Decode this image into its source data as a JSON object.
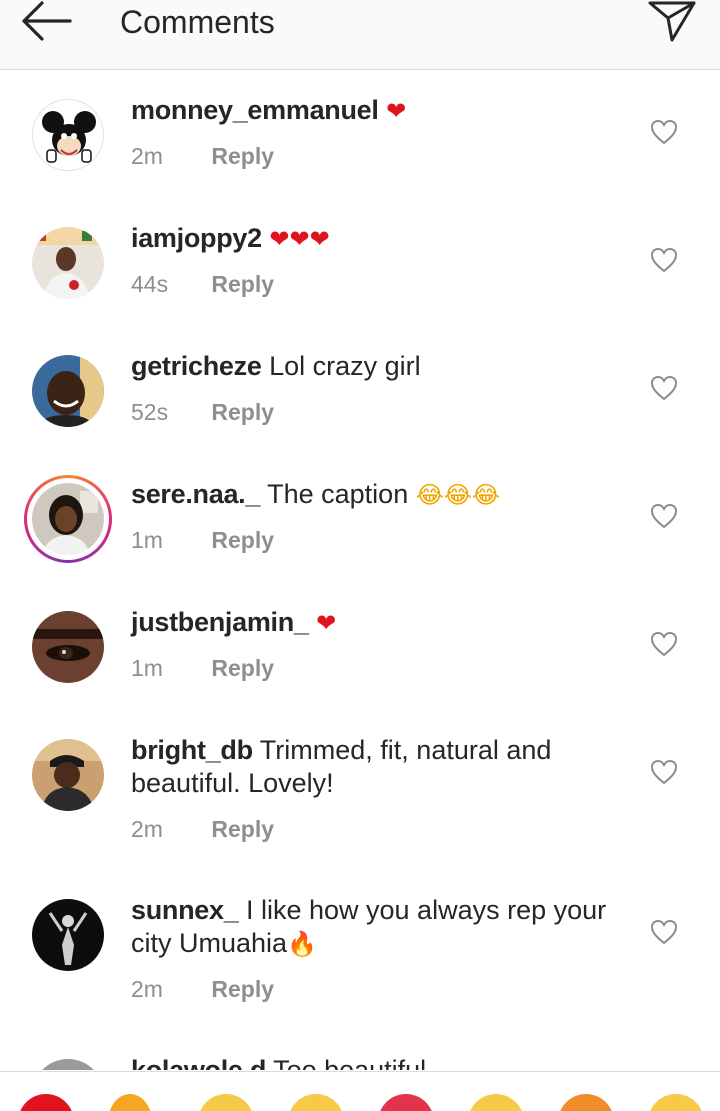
{
  "header": {
    "title": "Comments",
    "back_icon": "arrow-left-icon",
    "share_icon": "direct-send-icon"
  },
  "comments": [
    {
      "username": "monney_emmanuel",
      "text": "",
      "emoji": "❤",
      "time": "2m",
      "reply_label": "Reply",
      "avatar": "mickey-mouse-avatar"
    },
    {
      "username": "iamjoppy2",
      "text": "",
      "emoji": "❤❤❤",
      "time": "44s",
      "reply_label": "Reply",
      "avatar": "man-red-shirt-avatar"
    },
    {
      "username": "getricheze",
      "text": "Lol crazy girl",
      "emoji": "",
      "time": "52s",
      "reply_label": "Reply",
      "avatar": "smiling-man-avatar"
    },
    {
      "username": "sere.naa._",
      "text": "The caption",
      "emoji": "😂😂😂",
      "time": "1m",
      "reply_label": "Reply",
      "avatar": "woman-avatar-story"
    },
    {
      "username": "justbenjamin_",
      "text": "",
      "emoji": "❤",
      "time": "1m",
      "reply_label": "Reply",
      "avatar": "eye-closeup-avatar"
    },
    {
      "username": "bright_db",
      "text": "Trimmed, fit, natural and beautiful. Lovely!",
      "emoji": "",
      "time": "2m",
      "reply_label": "Reply",
      "avatar": "man-cap-avatar"
    },
    {
      "username": "sunnex_",
      "text": "I like how you always rep your city Umuahia",
      "emoji": "🔥",
      "time": "2m",
      "reply_label": "Reply",
      "avatar": "silhouette-dark-avatar"
    },
    {
      "username": "kolawole.d",
      "text": "Too beautiful",
      "emoji": "",
      "time": "",
      "reply_label": "",
      "avatar": "gray-avatar"
    }
  ],
  "emoji_bar": [
    "❤",
    "🔥",
    "👏",
    "😢",
    "😍",
    "😮",
    "😂",
    "😊"
  ],
  "colors": {
    "text": "#262626",
    "meta": "#8e8e8e",
    "heart_red": "#e0141e",
    "divider": "#dbdbdb"
  }
}
